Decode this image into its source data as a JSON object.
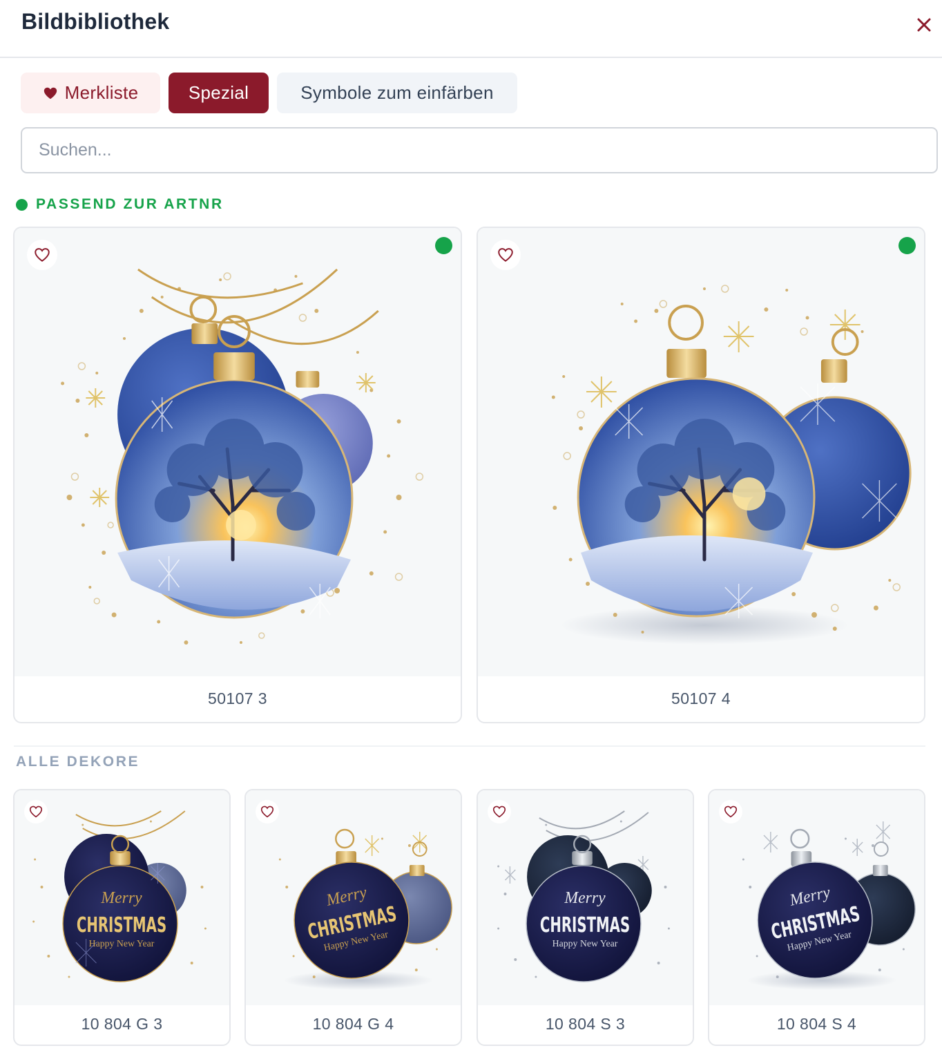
{
  "header": {
    "title": "Bildbibliothek",
    "close_icon": "close-icon"
  },
  "tabs": [
    {
      "label": "Merkliste",
      "icon": "heart-icon",
      "active": false
    },
    {
      "label": "Spezial",
      "active": true
    },
    {
      "label": "Symbole zum einfärben",
      "active": false
    }
  ],
  "search": {
    "placeholder": "Suchen...",
    "value": ""
  },
  "sections": {
    "matching": {
      "label": "PASSEND ZUR ARTNR",
      "items": [
        {
          "caption": "50107 3",
          "favorite_icon": "heart-outline-icon",
          "match_indicator": "green-dot"
        },
        {
          "caption": "50107 4",
          "favorite_icon": "heart-outline-icon",
          "match_indicator": "green-dot"
        }
      ]
    },
    "all": {
      "label": "ALLE DEKORE",
      "items": [
        {
          "caption": "10 804 G 3",
          "favorite_icon": "heart-outline-icon",
          "image_text": {
            "line1": "Merry",
            "line2": "CHRISTMAS",
            "line3": "Happy New Year"
          }
        },
        {
          "caption": "10 804 G 4",
          "favorite_icon": "heart-outline-icon",
          "image_text": {
            "line1": "Merry",
            "line2": "CHRISTMAS",
            "line3": "Happy New Year"
          }
        },
        {
          "caption": "10 804 S 3",
          "favorite_icon": "heart-outline-icon",
          "image_text": {
            "line1": "Merry",
            "line2": "CHRISTMAS",
            "line3": "Happy New Year"
          }
        },
        {
          "caption": "10 804 S 4",
          "favorite_icon": "heart-outline-icon",
          "image_text": {
            "line1": "Merry",
            "line2": "CHRISTMAS",
            "line3": "Happy New Year"
          }
        }
      ]
    }
  },
  "colors": {
    "brand": "#8b1a2b",
    "match_green": "#16a34a",
    "ornament_blue": "#2f4fa0",
    "ornament_navy": "#16193f",
    "gold": "#c9a050",
    "silver": "#9ca3af"
  }
}
